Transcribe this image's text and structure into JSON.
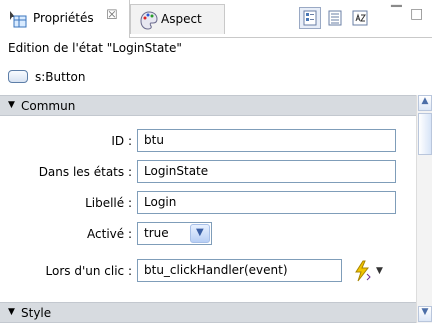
{
  "tabs": [
    {
      "label": "Propriétés",
      "close": "☒"
    },
    {
      "label": "Aspect"
    }
  ],
  "toolbar": {
    "icons": [
      "category-view-icon",
      "list-view-icon",
      "alphabetical-view-icon"
    ],
    "window_controls": [
      "minimize-icon",
      "maximize-icon"
    ]
  },
  "state_line": "Edition de l'état  \"LoginState\"",
  "component": {
    "label": "s:Button",
    "icon": "button-icon"
  },
  "sections": {
    "common": "Commun",
    "style": "Style"
  },
  "fields": {
    "id": {
      "label": "ID :",
      "value": "btu"
    },
    "states": {
      "label": "Dans les états :",
      "value": "LoginState"
    },
    "caption": {
      "label": "Libellé :",
      "value": "Login"
    },
    "enabled": {
      "label": "Activé :",
      "value": "true"
    },
    "click": {
      "label": "Lors d'un clic :",
      "value": "btu_clickHandler(event)"
    }
  },
  "colors": {
    "section_background": "#d7dbe0",
    "field_border": "#7f9db9",
    "accent": "#3a5fa5"
  }
}
